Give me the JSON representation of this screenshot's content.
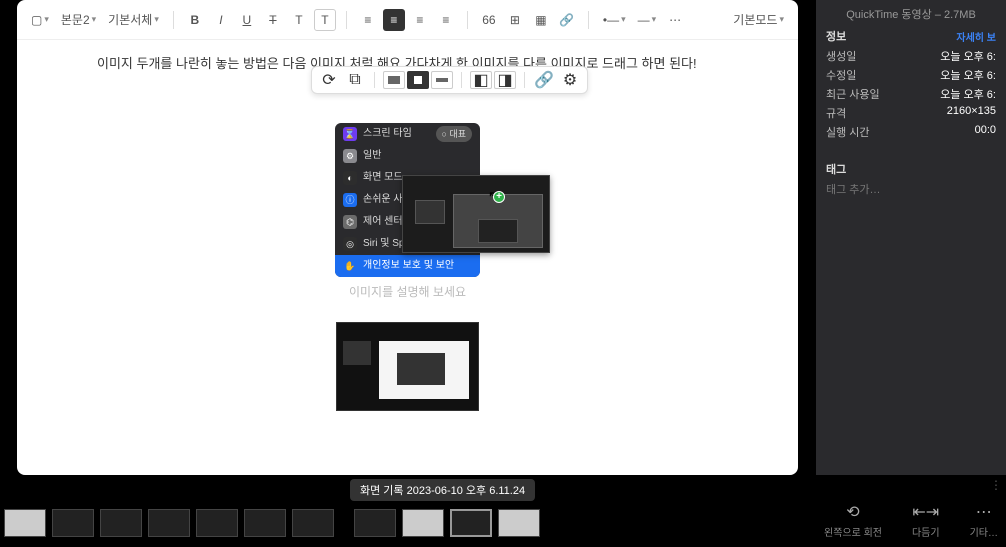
{
  "toolbar": {
    "para_style": "본문2",
    "font": "기본서체",
    "bold": "B",
    "italic": "I",
    "underline": "U",
    "strike": "T",
    "textshadow": "T",
    "font_color_glyph": "T",
    "quote": "66",
    "table": "▦",
    "link": "⌘",
    "list_ul": "•—",
    "list_ol": "—",
    "more": "⋯",
    "mode": "기본모드"
  },
  "document": {
    "paragraph": "이미지 두개를 나란히 놓는 방법은 다음 이미지 처럼 해요 가다차게 한 이미지를 다른 이미지로 드래그 하면 된다!",
    "caption_placeholder": "이미지를 설명해 보세요"
  },
  "image_toolbar": {
    "spinner": "⟳",
    "placeholder": "⧉",
    "settings": "⚙"
  },
  "settings_list": {
    "header": "스크린 타임",
    "rep_badge": "○ 대표",
    "items": [
      {
        "icon": "◐",
        "label": "일반",
        "color": "#8a8a8f"
      },
      {
        "icon": "◑",
        "label": "화면 모드",
        "color": "#2d2d2d"
      },
      {
        "icon": "ⓘ",
        "label": "손쉬운 사용",
        "color": "#1b6df0"
      },
      {
        "icon": "⌬",
        "label": "제어 센터",
        "color": "#6b6b6b"
      },
      {
        "icon": "◎",
        "label": "Siri 및 Spotlight",
        "color": "#2d2d2d"
      },
      {
        "icon": "✋",
        "label": "개인정보 보호 및 보안",
        "color": "#1b6df0"
      }
    ]
  },
  "inspector": {
    "file_title": "QuickTime 동영상 – 2.7MB",
    "section": "정보",
    "detail_link": "자세히 보",
    "rows": {
      "created": {
        "k": "생성일",
        "v": "오늘 오후 6:"
      },
      "modified": {
        "k": "수정일",
        "v": "오늘 오후 6:"
      },
      "lastused": {
        "k": "최근 사용일",
        "v": "오늘 오후 6:"
      },
      "dimensions": {
        "k": "규격",
        "v": "2160×135"
      },
      "duration": {
        "k": "실행 시간",
        "v": "00:0"
      }
    },
    "tag_head": "태그",
    "tag_add": "태그 추가…"
  },
  "tooltip": "화면 기록 2023-06-10 오후 6.11.24",
  "actions": {
    "rotate": "왼쪽으로 회전",
    "markup": "다듬기",
    "more": "기타…"
  },
  "icons": {
    "image_dd": "▢",
    "align_left": "≡",
    "align_center_active": "≡",
    "align_right": "≡",
    "align_justify": "≡"
  }
}
